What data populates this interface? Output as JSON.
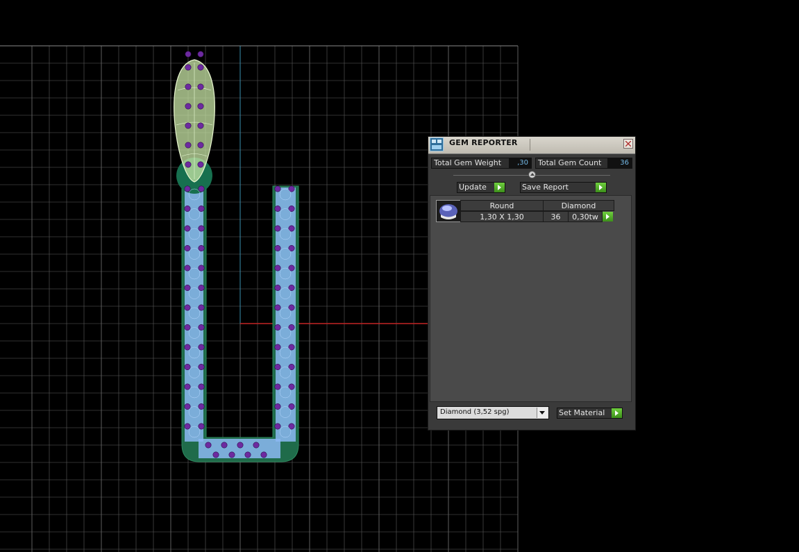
{
  "viewport": {
    "grid_color": "#5e5e5e",
    "axis_x_color": "#c42424",
    "axis_y_color": "#3a8fb0",
    "band_color": "#1f6b4a",
    "gem_fill": "#8cb8f2",
    "prong_color": "#6d2aa0"
  },
  "gem_reporter": {
    "title": "GEM REPORTER",
    "total_weight_label": "Total Gem Weight",
    "total_weight_value": ",30",
    "total_count_label": "Total Gem Count",
    "total_count_value": "36",
    "update_label": "Update",
    "save_report_label": "Save Report",
    "table": {
      "headers": [
        "Round",
        "Diamond"
      ],
      "size": "1,30 X 1,30",
      "count": "36",
      "weight": "0,30tw"
    },
    "material_selected": "Diamond     (3,52 spg)",
    "set_material_label": "Set Material"
  }
}
